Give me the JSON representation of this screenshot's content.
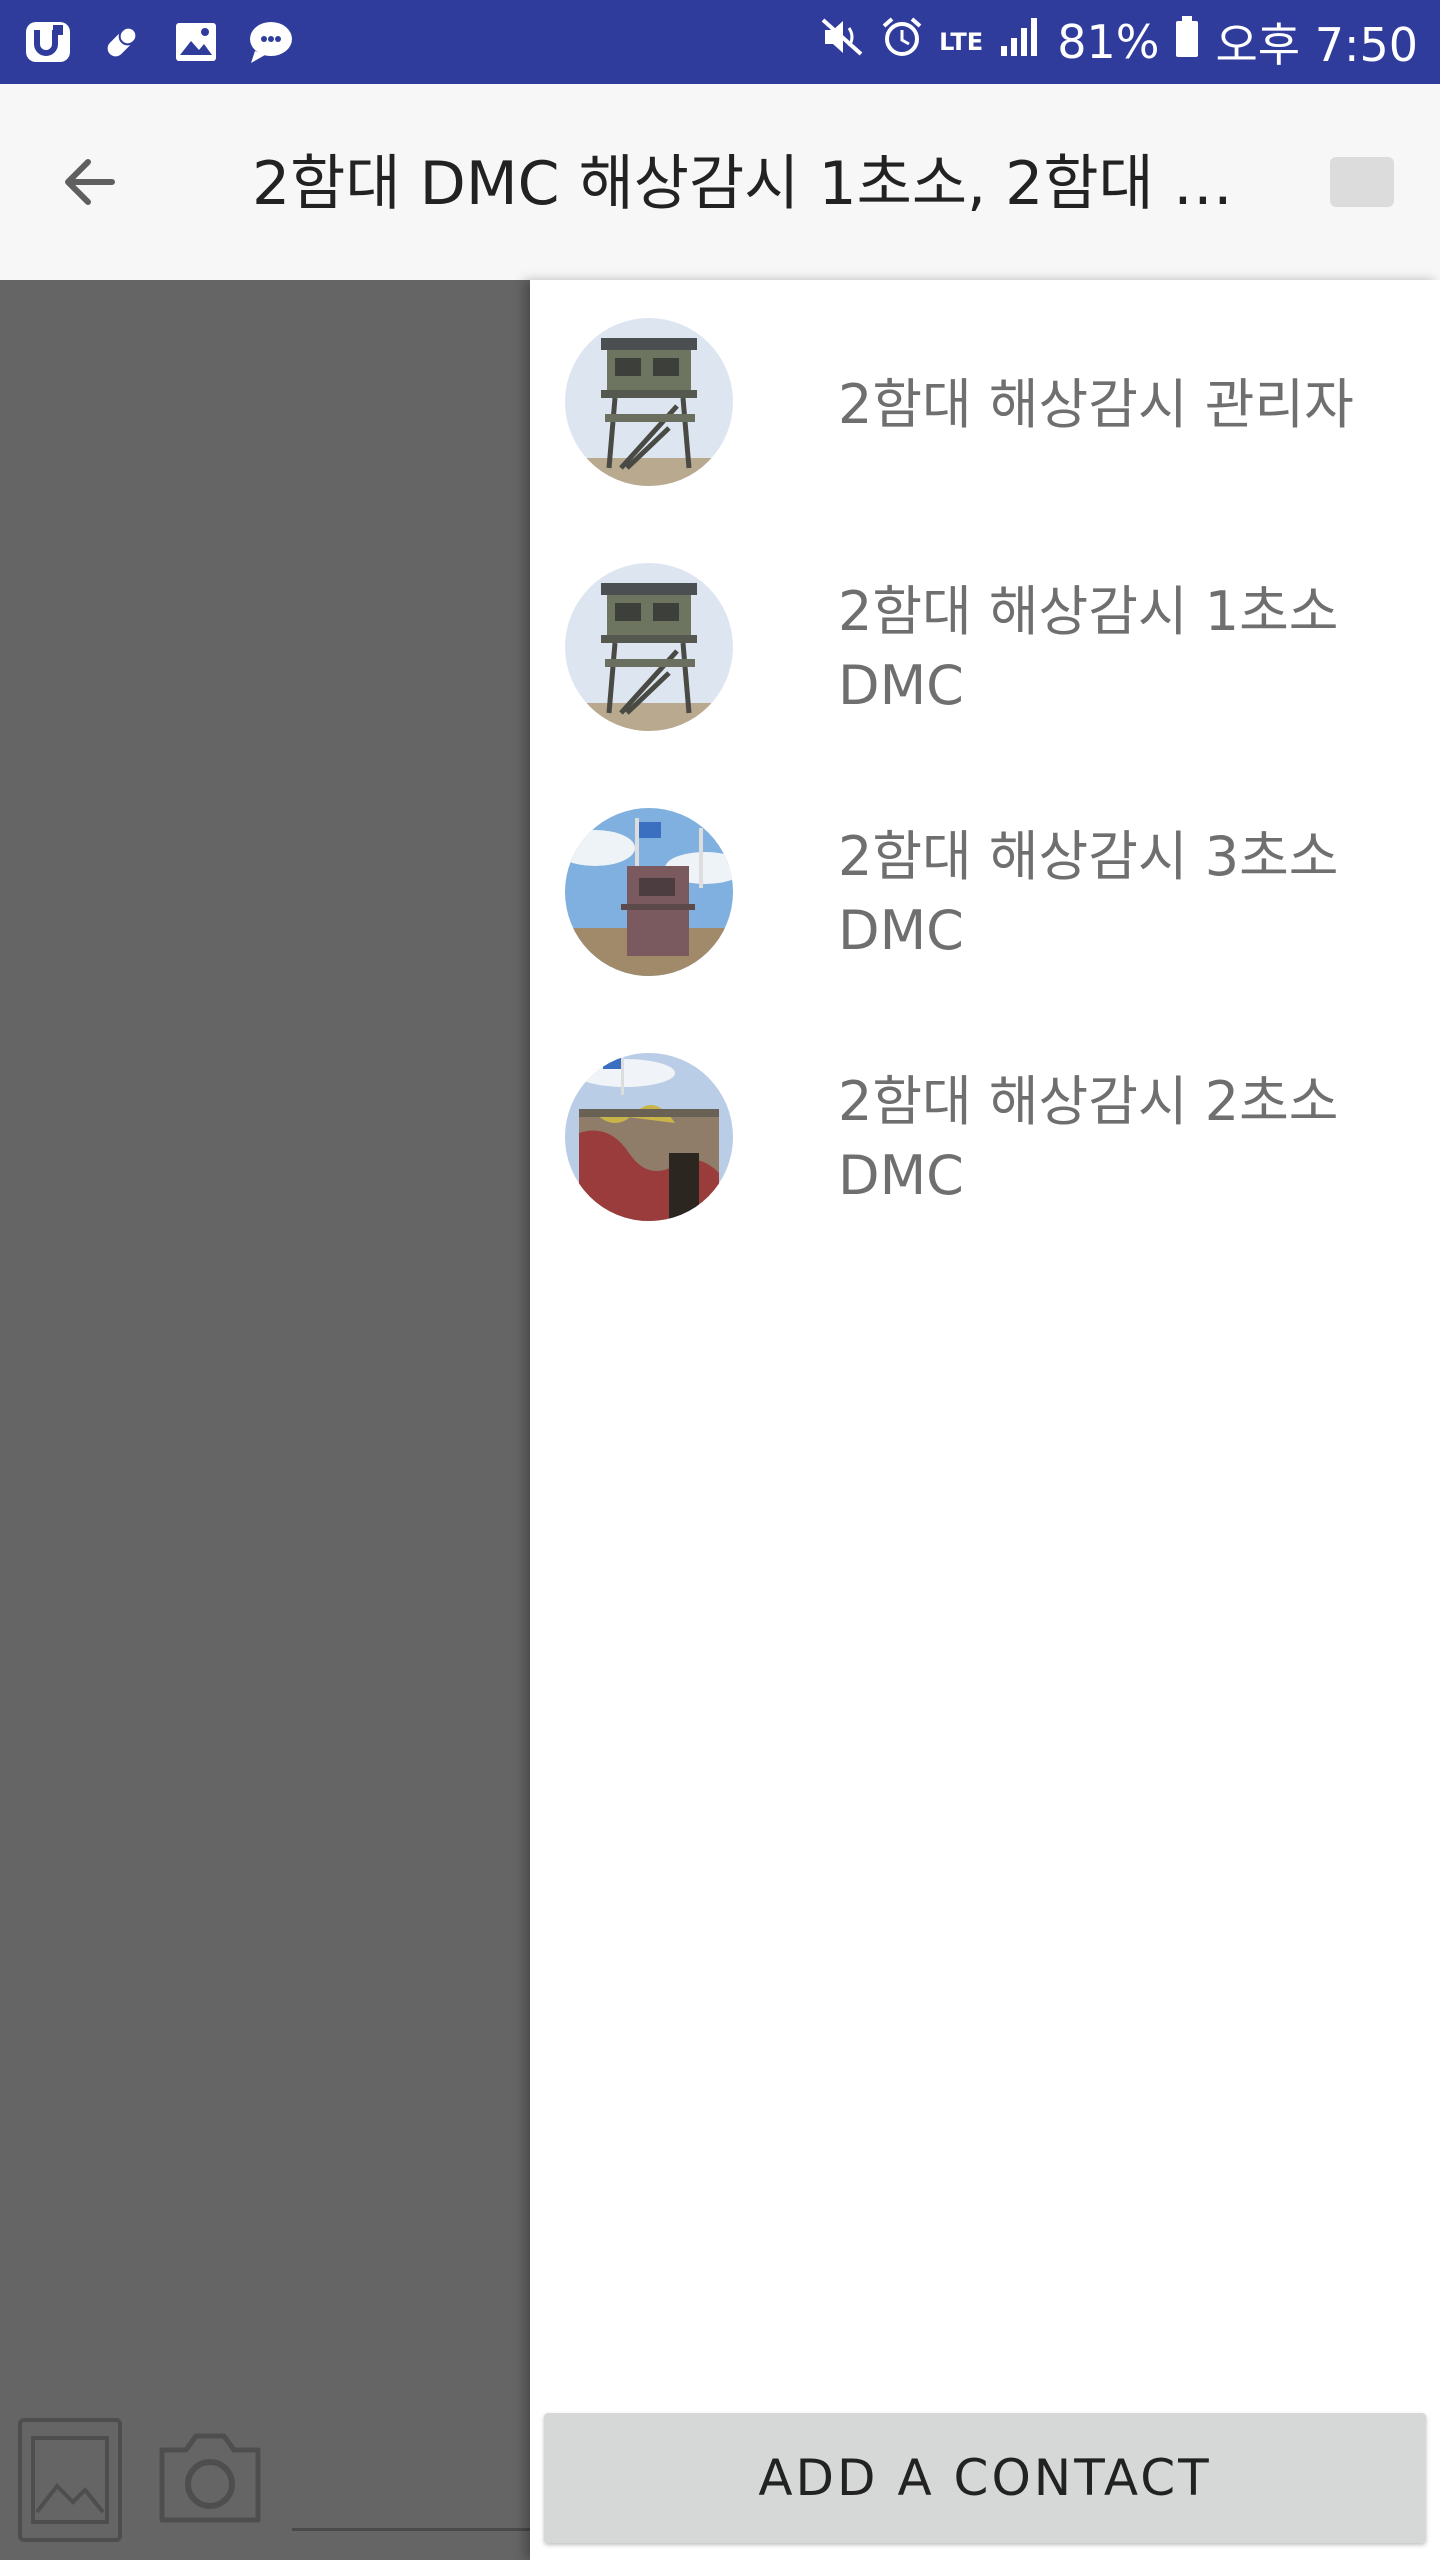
{
  "status_bar": {
    "left_icons": [
      "u-plus-app-icon",
      "pill-icon",
      "image-icon",
      "chat-bubble-icon"
    ],
    "battery_percent": "81%",
    "time": "오후 7:50",
    "network": "LTE"
  },
  "app_bar": {
    "title": "2함대 DMC 해상감시 1초소, 2함대 DM…"
  },
  "drawer": {
    "contacts": [
      {
        "name": "2함대 해상감시 관리자",
        "avatar": "guard-tower-photo"
      },
      {
        "name": "2함대 해상감시 1초소 DMC",
        "avatar": "guard-tower-photo"
      },
      {
        "name": "2함대 해상감시 3초소 DMC",
        "avatar": "flag-post-photo"
      },
      {
        "name": "2함대 해상감시 2초소 DMC",
        "avatar": "camouflage-bunker-photo"
      }
    ],
    "add_contact_label": "ADD A CONTACT"
  },
  "composer": {
    "icons": [
      "gallery-icon",
      "camera-icon"
    ]
  },
  "colors": {
    "status_bar": "#2f3c9c",
    "scrim": "#656565",
    "button": "#d6d8d8"
  }
}
